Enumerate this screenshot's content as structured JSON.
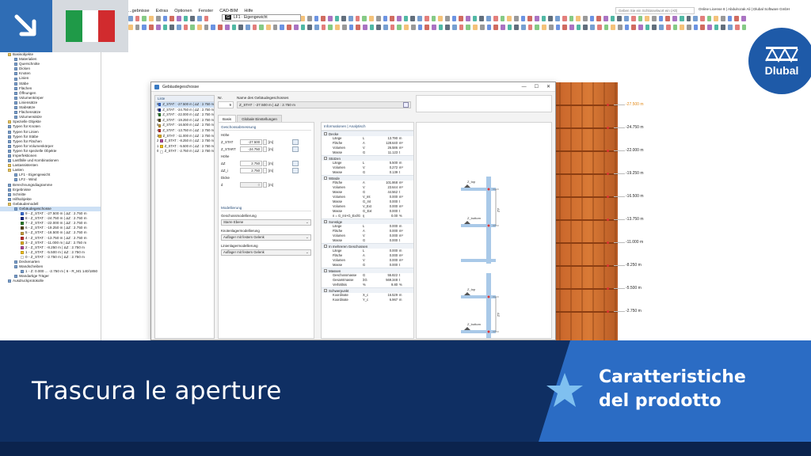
{
  "menu": {
    "items": [
      "...gebnisse",
      "Extras",
      "Optionen",
      "Fenster",
      "CAD-BIM",
      "Hilfe"
    ],
    "search_placeholder": "Geben Sie ein Schlüsselwort ein (Alt)",
    "license": "Online License 8 | Abdulrozak Ali | Dlubal Software GmbH"
  },
  "toolbar": {
    "loadcase_tag": "G",
    "loadcase": "LF1 · Eigengewicht"
  },
  "navigator": {
    "items": [
      "Basisobjekte",
      "Materialien",
      "Querschnitte",
      "Dicken",
      "Knoten",
      "Linien",
      "Stäbe",
      "Flächen",
      "Öffnungen",
      "Volumenkörper",
      "Liniensätze",
      "Stabsätze",
      "Flächensätze",
      "Volumensätze",
      "Spezielle Objekte",
      "Typen für Knoten",
      "Typen für Linien",
      "Typen für Stäbe",
      "Typen für Flächen",
      "Typen für Volumenkörper",
      "Typen für spezielle Objekte",
      "Imperfektionen",
      "Lastfälle und Kombinationen",
      "Lastassistenten",
      "Lasten",
      "LF1 - Eigengewicht",
      "LF2 - Wind",
      "Berechnungsdiagramme",
      "Ergebnisse",
      "Schnitte",
      "Hilfsobjekte",
      "Gebäudemodell",
      "Gebäudegeschosse",
      "9 - Z_STAT : -27.500 m | ΔZ : 2.750 m",
      "8 - Z_STAT : -24.750 m | ΔZ : 2.750 m",
      "7 - Z_STAT : -22.000 m | ΔZ : 2.750 m",
      "6 - Z_STAT : -19.250 m | ΔZ : 2.750 m",
      "5 - Z_STAT : -16.500 m | ΔZ : 2.750 m",
      "4 - Z_STAT : -13.750 m | ΔZ : 2.750 m",
      "3 - Z_STAT : -11.000 m | ΔZ : 2.750 m",
      "2 - Z_STAT : -8.250 m | ΔZ : 2.750 m",
      "1 - Z_STAT : -5.500 m | ΔZ : 2.750 m",
      "0 - Z_STAT : -2.750 m | ΔZ : 2.750 m",
      "Deckenarten",
      "Wandscheiben",
      "1 - Z: 0.000 ... -2.750 m | 6 - R_M1 140/1850",
      "Wandartige Träger",
      "Ausdruckprotokolle"
    ]
  },
  "dialog": {
    "title": "Gebäudegeschosse",
    "list_header": "Liste",
    "list_items": [
      {
        "num": "9",
        "label": "Z_STAT : -27.500 m | ΔZ : 2.750 m"
      },
      {
        "num": "8",
        "label": "Z_STAT : -24.750 m | ΔZ : 2.750 m"
      },
      {
        "num": "7",
        "label": "Z_STAT : -22.000 m | ΔZ : 2.750 m"
      },
      {
        "num": "6",
        "label": "Z_STAT : -19.250 m | ΔZ : 2.750 m"
      },
      {
        "num": "5",
        "label": "Z_STAT : -16.500 m | ΔZ : 2.750 m"
      },
      {
        "num": "4",
        "label": "Z_STAT : -13.750 m | ΔZ : 2.750 m"
      },
      {
        "num": "3",
        "label": "Z_STAT : -11.000 m | ΔZ : 2.750 m"
      },
      {
        "num": "2",
        "label": "Z_STAT : -8.250 m | ΔZ : 2.750 m"
      },
      {
        "num": "1",
        "label": "Z_STAT : -5.500 m | ΔZ : 2.750 m"
      },
      {
        "num": "0",
        "label": "Z_STAT : -2.750 m | ΔZ : 2.750 m"
      }
    ],
    "list_colors": [
      "#3a6fd8",
      "#1a2e8a",
      "#2a7d2a",
      "#5a4a1a",
      "#c8a040",
      "#c03030",
      "#e0b020",
      "#b04a9a",
      "#f0c020",
      "#ffffff"
    ],
    "no_label": "Nr.",
    "no_value": "9",
    "name_label": "Name des Gebäudegeschosses",
    "name_value": "Z_STAT : -27.500 m | ΔZ : 2.750 m",
    "tabs": [
      "Basis",
      "Globale Einstellungen"
    ],
    "geometry": {
      "section": "Geschossabmessung",
      "height_label": "Höhe",
      "z_stat_name": "Z_STAT",
      "z_stat_value": "-27.500",
      "z_start_name": "Z_START",
      "z_start_value": "-24.750",
      "unit": "[m]",
      "height2_label": "Höhe",
      "dz_name": "ΔZ",
      "dz_value": "2.750",
      "dz2_name": "ΔZ_i",
      "dz2_value": "2.750",
      "thickness_label": "Dicke",
      "d_name": "d",
      "d_value": "0"
    },
    "modeling": {
      "section": "Modellierung",
      "floor_label": "Geschossmodellierung",
      "floor_value": "Starre Ebene",
      "node_label": "Knotenlagermodellierung",
      "node_value": "Auflager mit festem Gelenk",
      "line_label": "Linienlagermodellierung",
      "line_value": "Auflager mit festem Gelenk"
    },
    "info": {
      "header": "Informationen | Analytisch",
      "groups": [
        {
          "name": "Decke",
          "rows": [
            [
              "Länge",
              "L",
              "13.790",
              "m"
            ],
            [
              "Fläche",
              "A",
              "128.640",
              "m²"
            ],
            [
              "Volumen",
              "V",
              "26.586",
              "m³"
            ],
            [
              "Masse",
              "G",
              "11.123",
              "t"
            ]
          ]
        },
        {
          "name": "Stützen",
          "rows": [
            [
              "Länge",
              "L",
              "5.500",
              "m"
            ],
            [
              "Volumen",
              "V",
              "0.272",
              "m³"
            ],
            [
              "Masse",
              "G",
              "0.139",
              "t"
            ]
          ]
        },
        {
          "name": "Wände",
          "rows": [
            [
              "Fläche",
              "A",
              "101.868",
              "m²"
            ],
            [
              "Volumen",
              "V",
              "23.644",
              "m³"
            ],
            [
              "Masse",
              "G",
              "44.562",
              "t"
            ],
            [
              "Volumen",
              "V_Int",
              "0.000",
              "m³"
            ],
            [
              "Masse",
              "G_Int",
              "0.000",
              "t"
            ],
            [
              "Volumen",
              "V_Ext",
              "0.000",
              "m³"
            ],
            [
              "Masse",
              "G_Ext",
              "0.000",
              "t"
            ],
            [
              "n = G_Int+G_Ext/G",
              "η",
              "0.00",
              "%"
            ]
          ]
        },
        {
          "name": "Sonstige",
          "rows": [
            [
              "Länge",
              "L",
              "0.000",
              "m"
            ],
            [
              "Fläche",
              "A",
              "0.000",
              "m²"
            ],
            [
              "Volumen",
              "V",
              "0.000",
              "m³"
            ],
            [
              "Masse",
              "G",
              "0.000",
              "t"
            ]
          ]
        },
        {
          "name": "In mehreren Geschossen",
          "rows": [
            [
              "Länge",
              "L",
              "0.000",
              "m"
            ],
            [
              "Fläche",
              "A",
              "0.000",
              "m²"
            ],
            [
              "Volumen",
              "V",
              "0.000",
              "m³"
            ],
            [
              "Masse",
              "G",
              "0.000",
              "t"
            ]
          ]
        },
        {
          "name": "Massen",
          "rows": [
            [
              "Geschossmasse",
              "G",
              "55.822",
              "t"
            ],
            [
              "Gesamtmasse",
              "ΣG",
              "569.348",
              "t"
            ],
            [
              "Verhältnis",
              "%",
              "9.80",
              "%"
            ]
          ]
        },
        {
          "name": "Schwerpunkt",
          "rows": [
            [
              "Koordinate",
              "X_c",
              "16.529",
              "m"
            ],
            [
              "Koordinate",
              "Y_c",
              "6.967",
              "m"
            ]
          ]
        }
      ]
    },
    "diagram": {
      "labels": [
        "Z_top",
        "Z_bottom",
        "ΔZ",
        "Z_top",
        "Z_bottom",
        "ΔZ"
      ]
    }
  },
  "model": {
    "elevations": [
      "-27.500 m",
      "-24.750 m",
      "-22.000 m",
      "-19.250 m",
      "-16.500 m",
      "-13.750 m",
      "-11.000 m",
      "-8.250 m",
      "-5.500 m",
      "-2.750 m"
    ]
  },
  "branding": {
    "logo_text": "Dlubal",
    "flag_colors": [
      "#1f9a48",
      "#ffffff",
      "#d12b2e"
    ],
    "accent": "#2b6cc4"
  },
  "banner": {
    "title": "Trascura le aperture",
    "subtitle_line1": "Caratteristiche",
    "subtitle_line2": "del prodotto"
  }
}
